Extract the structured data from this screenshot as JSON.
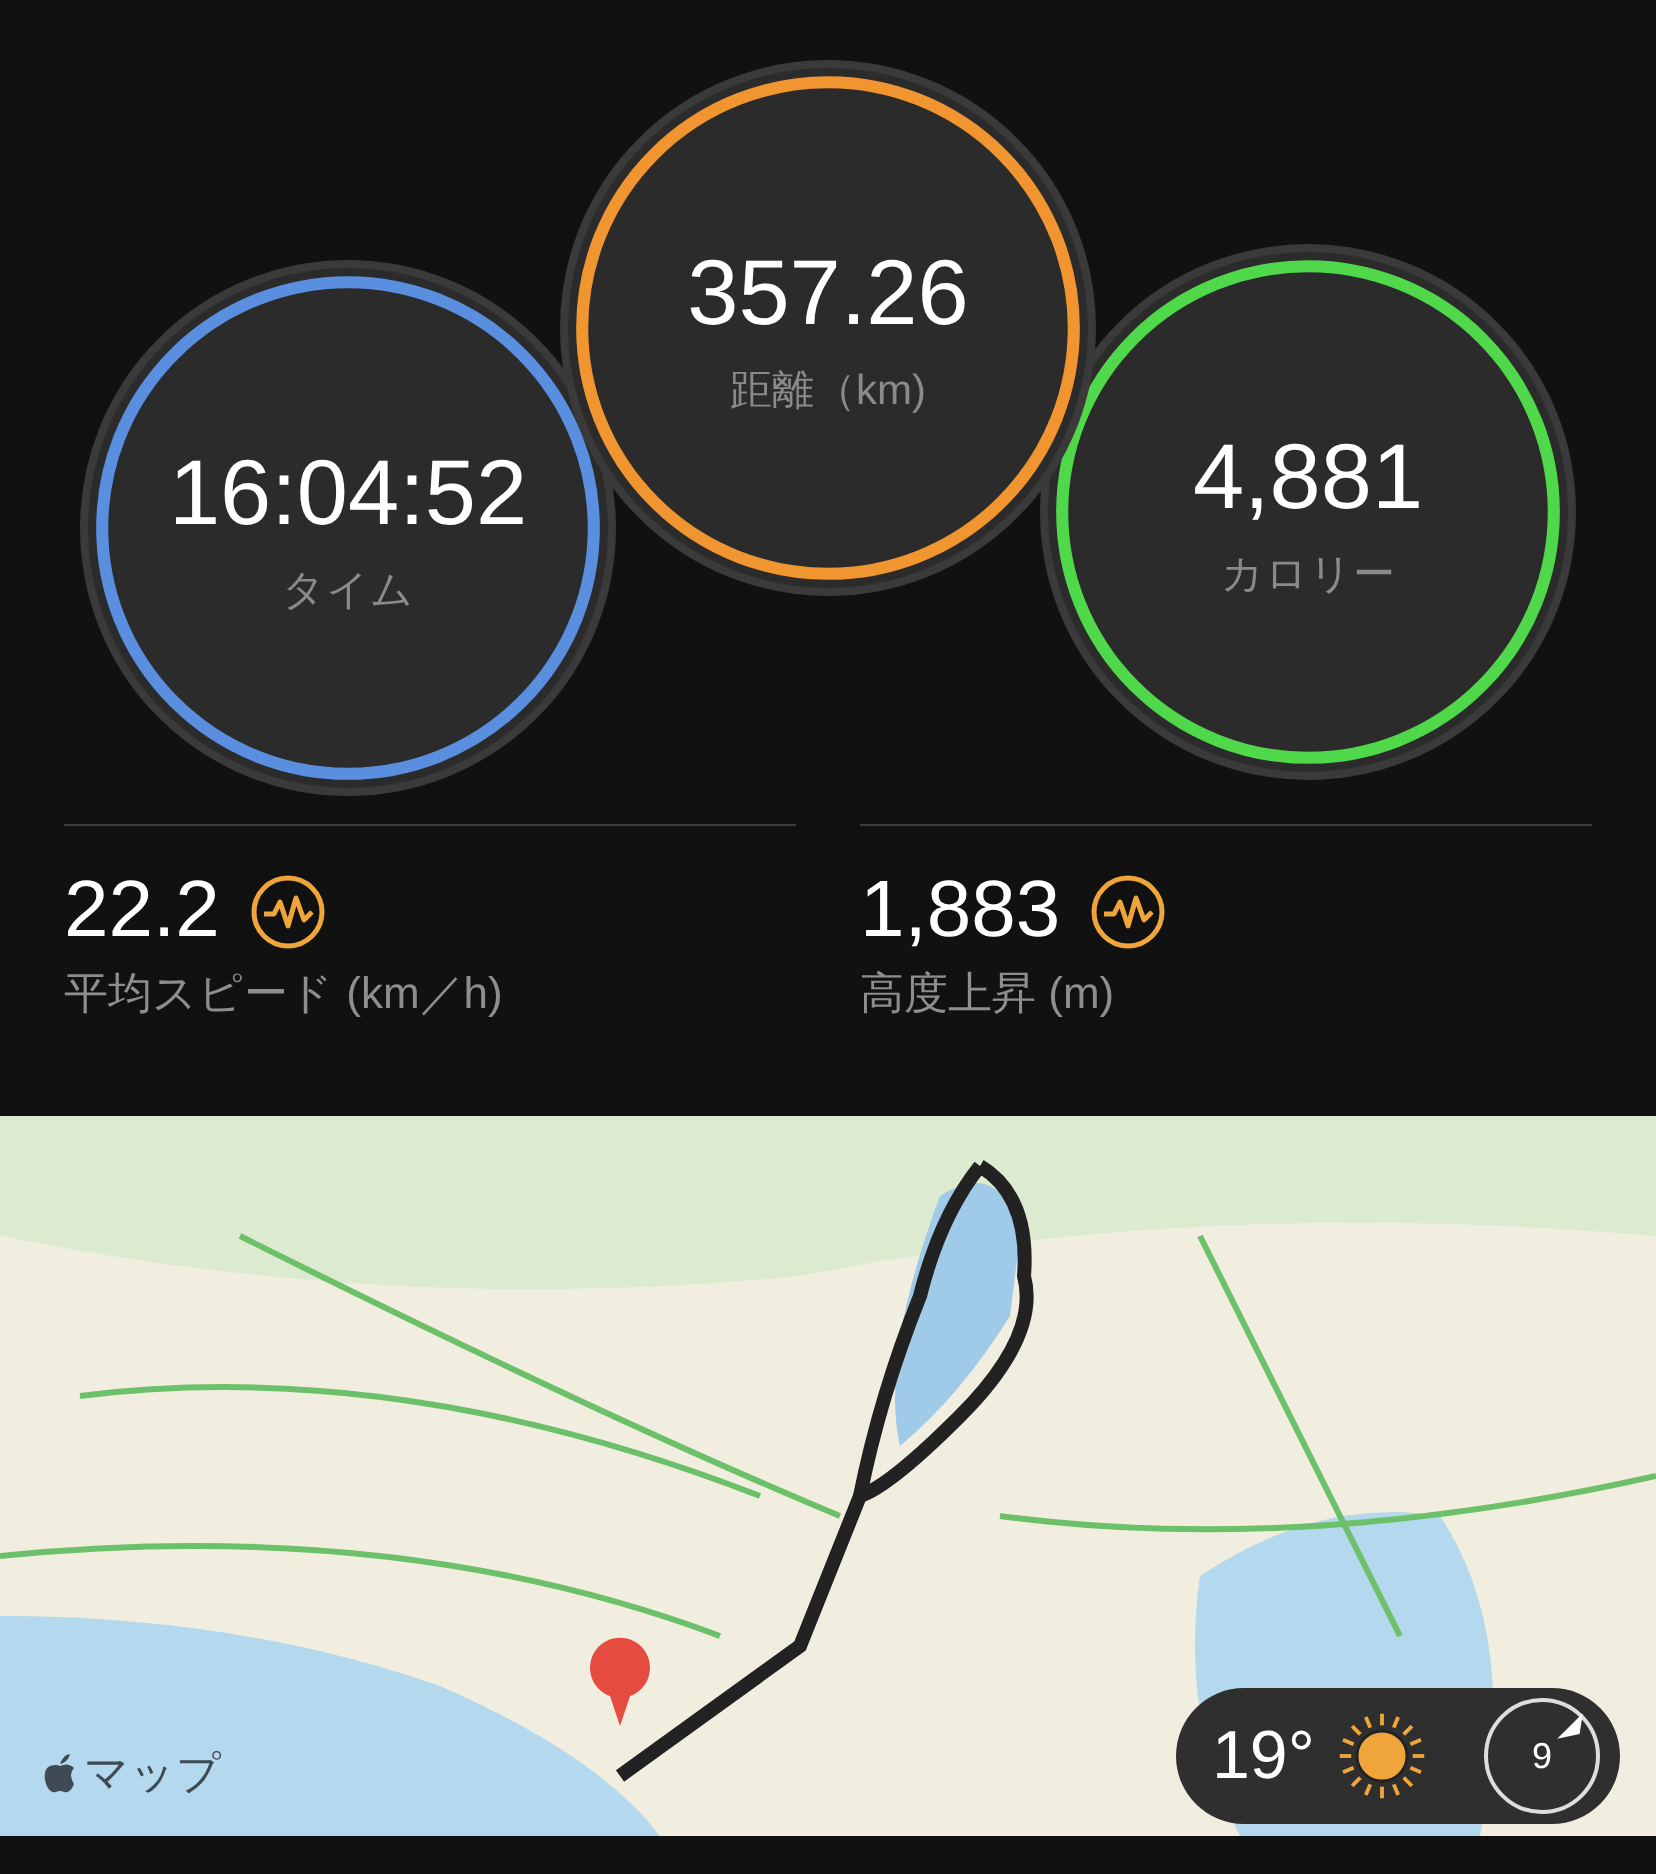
{
  "rings": [
    {
      "value": "16:04:52",
      "label": "タイム",
      "color": "#5a8fe0"
    },
    {
      "value": "357.26",
      "label": "距離（km)",
      "color": "#f0952f"
    },
    {
      "value": "4,881",
      "label": "カロリー",
      "color": "#4fd84a"
    }
  ],
  "stats": [
    {
      "value": "22.2",
      "label": "平均スピード (km／h)"
    },
    {
      "value": "1,883",
      "label": "高度上昇 (m)"
    }
  ],
  "map": {
    "kind": "picture",
    "attribution": "マップ",
    "weather": {
      "temperature": "19°",
      "wind": "9"
    }
  }
}
